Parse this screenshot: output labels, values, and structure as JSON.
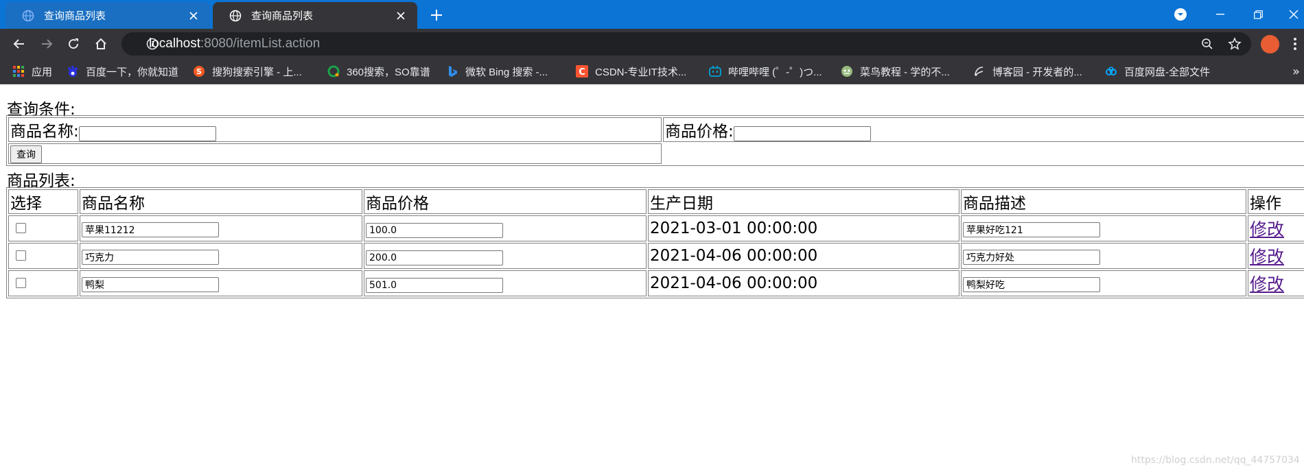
{
  "browser": {
    "tabs": [
      {
        "title": "查询商品列表",
        "active": false
      },
      {
        "title": "查询商品列表",
        "active": true
      }
    ],
    "url_host": "localhost",
    "url_path": ":8080/itemList.action",
    "bookmarks": [
      {
        "label": "应用",
        "icon": "apps-grid-icon"
      },
      {
        "label": "百度一下，你就知道",
        "icon": "baidu-icon"
      },
      {
        "label": "搜狗搜索引擎 - 上...",
        "icon": "sogou-icon"
      },
      {
        "label": "360搜索，SO靠谱",
        "icon": "so360-icon"
      },
      {
        "label": "微软 Bing 搜索 -...",
        "icon": "bing-icon"
      },
      {
        "label": "CSDN-专业IT技术...",
        "icon": "csdn-icon"
      },
      {
        "label": "哔哩哔哩 (゜-゜)つ...",
        "icon": "bilibili-icon"
      },
      {
        "label": "菜鸟教程 - 学的不...",
        "icon": "runoob-icon"
      },
      {
        "label": "博客园 - 开发者的...",
        "icon": "cnblogs-icon"
      },
      {
        "label": "百度网盘-全部文件",
        "icon": "baidu-pan-icon"
      }
    ],
    "colors": {
      "tabbar": "#0b74d5",
      "toolbar": "#353539"
    }
  },
  "page": {
    "query_heading": "查询条件:",
    "name_label": "商品名称:",
    "price_label": "商品价格:",
    "query_button": "查询",
    "list_heading": "商品列表:",
    "columns": [
      "选择",
      "商品名称",
      "商品价格",
      "生产日期",
      "商品描述",
      "操作"
    ],
    "rows": [
      {
        "name": "苹果11212",
        "price": "100.0",
        "date": "2021-03-01 00:00:00",
        "desc": "苹果好吃121",
        "action": "修改"
      },
      {
        "name": "巧克力",
        "price": "200.0",
        "date": "2021-04-06 00:00:00",
        "desc": "巧克力好处",
        "action": "修改"
      },
      {
        "name": "鸭梨",
        "price": "501.0",
        "date": "2021-04-06 00:00:00",
        "desc": "鸭梨好吃",
        "action": "修改"
      }
    ],
    "watermark": "https://blog.csdn.net/qq_44757034"
  }
}
